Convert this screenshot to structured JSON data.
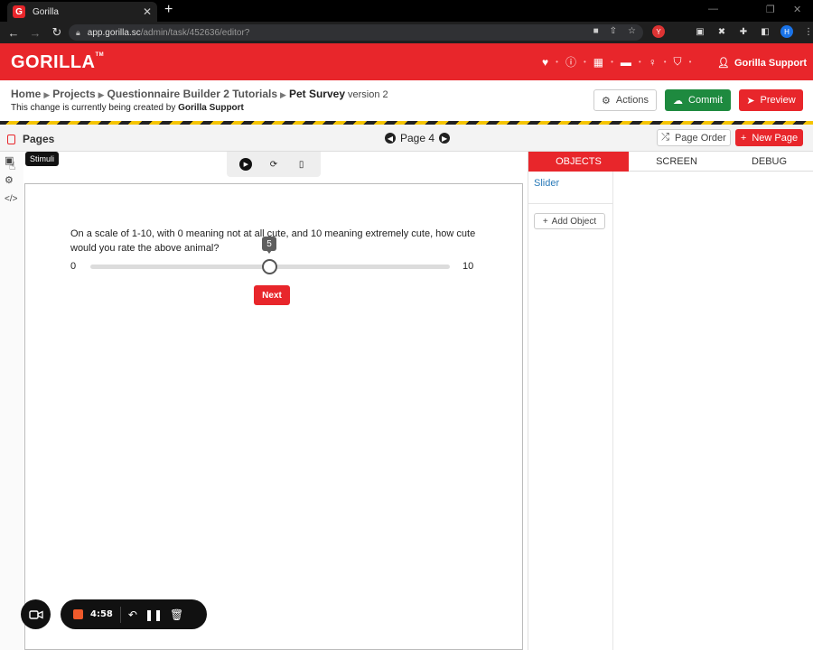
{
  "browser": {
    "tab_title": "Gorilla",
    "tab_favicon": "G",
    "tab_close": "✕",
    "new_tab": "+",
    "url_host": "app.gorilla.sc",
    "url_path": "/admin/task/452636/editor?",
    "avatar_letter": "H"
  },
  "app": {
    "logo": "GORILLA",
    "logo_tm": "TM",
    "user_name": "Gorilla Support",
    "accent_color": "#e8262b"
  },
  "breadcrumb": {
    "items": [
      "Home",
      "Projects",
      "Questionnaire Builder 2 Tutorials"
    ],
    "current": "Pet Survey",
    "version": "version 2",
    "status_prefix": "This change is currently being created by",
    "status_user": "Gorilla Support"
  },
  "toolbar": {
    "actions_label": "Actions",
    "commit_label": "Commit",
    "preview_label": "Preview"
  },
  "pages_bar": {
    "title": "Pages",
    "current_page": "Page 4",
    "page_order_label": "Page Order",
    "new_page_label": "New Page"
  },
  "tooltip": {
    "stimuli": "Stimuli"
  },
  "canvas": {
    "question": "On a scale of 1-10, with 0 meaning not at all cute, and 10 meaning extremely cute, how cute would you rate the above animal?",
    "slider_min": "0",
    "slider_max": "10",
    "slider_value": "5",
    "next_label": "Next"
  },
  "right_panel": {
    "tabs": [
      "OBJECTS",
      "SCREEN",
      "DEBUG"
    ],
    "objects": [
      "Slider"
    ],
    "add_object_label": "Add Object"
  },
  "recorder": {
    "time": "4:58"
  }
}
